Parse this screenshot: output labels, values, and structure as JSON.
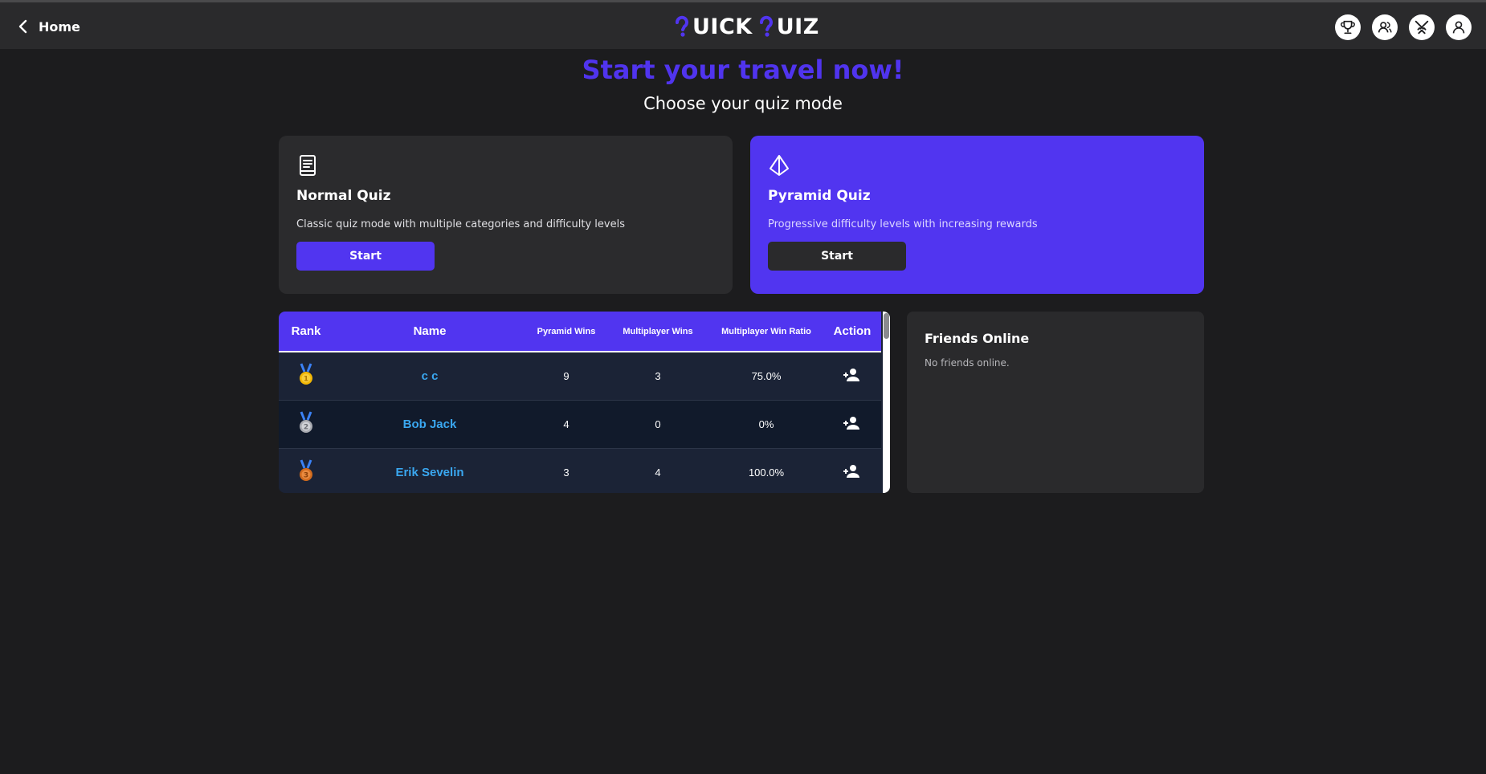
{
  "topbar": {
    "home_label": "Home",
    "logo_text_1": "UICK",
    "logo_text_2": "UIZ",
    "logo_accent": "#5135f0",
    "icons": [
      "trophy-icon",
      "friends-icon",
      "battle-swords-icon",
      "profile-icon"
    ]
  },
  "hero": {
    "title": "Start your travel now!",
    "subtitle": "Choose your quiz mode"
  },
  "modes": [
    {
      "icon": "book-icon",
      "title": "Normal Quiz",
      "description": "Classic quiz mode with multiple categories and difficulty levels",
      "button_label": "Start"
    },
    {
      "icon": "pyramid-icon",
      "title": "Pyramid Quiz",
      "description": "Progressive difficulty levels with increasing rewards",
      "button_label": "Start"
    }
  ],
  "leaderboard": {
    "headers": {
      "rank": "Rank",
      "name": "Name",
      "pyramid_wins": "Pyramid Wins",
      "multiplayer_wins": "Multiplayer Wins",
      "ratio": "Multiplayer Win Ratio",
      "action": "Action"
    },
    "rows": [
      {
        "medal": "gold-medal-icon",
        "name": "c c",
        "pyramid_wins": "9",
        "multiplayer_wins": "3",
        "ratio": "75.0%"
      },
      {
        "medal": "silver-medal-icon",
        "name": "Bob Jack",
        "pyramid_wins": "4",
        "multiplayer_wins": "0",
        "ratio": "0%"
      },
      {
        "medal": "bronze-medal-icon",
        "name": "Erik Sevelin",
        "pyramid_wins": "3",
        "multiplayer_wins": "4",
        "ratio": "100.0%"
      }
    ]
  },
  "friends": {
    "title": "Friends Online",
    "empty_text": "No friends online."
  },
  "colors": {
    "background": "#1c1c1e",
    "accent": "#5135f0",
    "panel": "#2a2a2c",
    "link_blue": "#3aa7f0"
  }
}
